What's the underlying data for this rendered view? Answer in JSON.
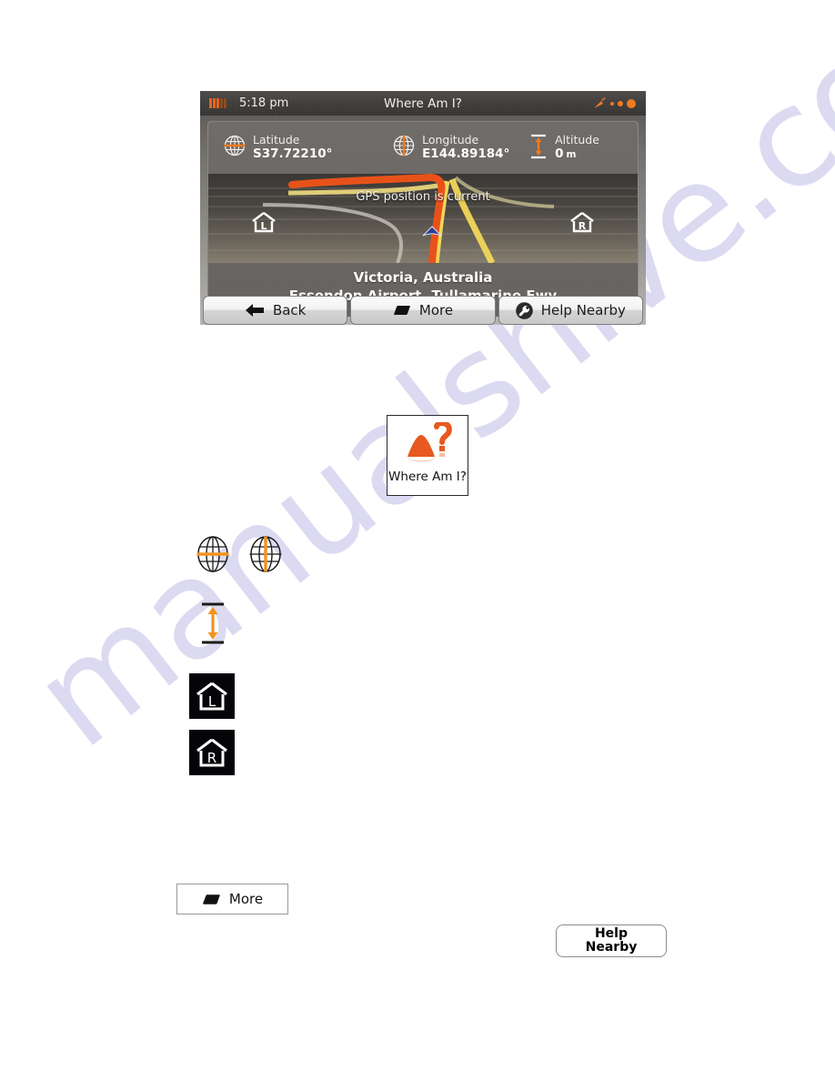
{
  "watermark": {
    "text": "manualshive.com"
  },
  "device": {
    "status_bar": {
      "time": "5:18 pm",
      "screen_title": "Where Am I?",
      "battery_icon": "battery-icon",
      "satellite_icon": "satellite-dish-icon",
      "signal_dots": 3
    },
    "coordinates": [
      {
        "label": "Latitude",
        "value": "S37.72210°",
        "unit": "",
        "icon": "globe-horizontal-icon"
      },
      {
        "label": "Longitude",
        "value": "E144.89184°",
        "unit": "",
        "icon": "globe-vertical-icon"
      },
      {
        "label": "Altitude",
        "value": "0",
        "unit": "m",
        "icon": "altitude-arrow-icon"
      }
    ],
    "map": {
      "gps_message": "GPS position is current",
      "marker_left": "L",
      "marker_right": "R"
    },
    "address": {
      "line1": "Victoria, Australia",
      "line2": "Essendon Airport, Tullamarine Fwy"
    },
    "buttons": [
      {
        "label": "Back",
        "icon": "back-arrow-icon"
      },
      {
        "label": "More",
        "icon": "more-tile-icon"
      },
      {
        "label": "Help Nearby",
        "icon": "wrench-icon"
      }
    ]
  },
  "callouts": {
    "where_am_i_tile": {
      "label": "Where Am I?",
      "icon": "where-am-i-icon"
    },
    "globe_horizontal": {
      "icon": "globe-horizontal-icon"
    },
    "globe_vertical": {
      "icon": "globe-vertical-icon"
    },
    "altitude": {
      "icon": "altitude-arrow-icon"
    },
    "house_left": {
      "letter": "L",
      "icon": "house-left-icon"
    },
    "house_right": {
      "letter": "R",
      "icon": "house-right-icon"
    },
    "more_button": {
      "label": "More",
      "icon": "more-tile-icon"
    },
    "help_nearby_button": {
      "line1": "Help",
      "line2": "Nearby"
    }
  },
  "colors": {
    "accent_orange": "#ef7a21",
    "route_orange": "#e8521a",
    "route_yellow": "#f2d04a",
    "watermark": "#d7d4ef"
  }
}
